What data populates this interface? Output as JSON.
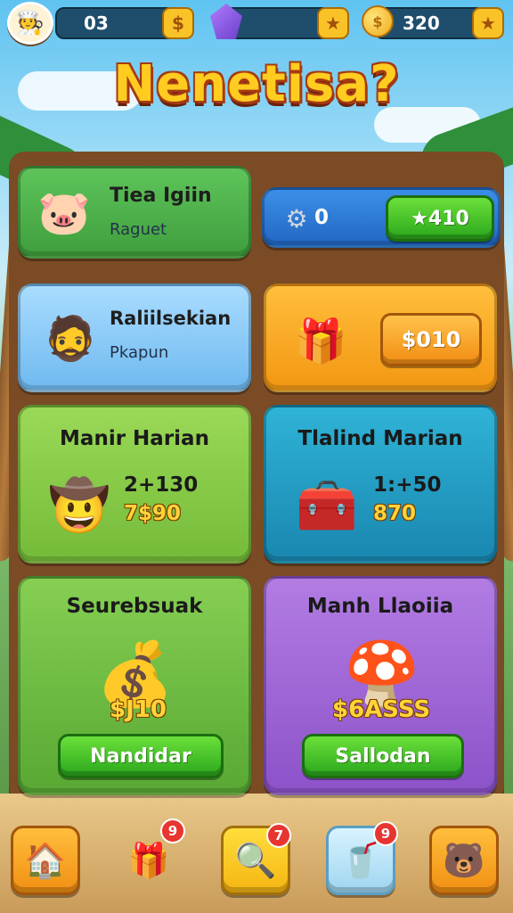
{
  "topbar": {
    "avatar_icon": "chef-avatar-icon",
    "level_value": "03",
    "level_badge_icon": "dollar-icon",
    "gem_icon": "purple-gem-icon",
    "gem_badge_icon": "star-icon",
    "coin_value": "320",
    "coin_badge_icon": "star-icon"
  },
  "title": "Nenetisa?",
  "cards": {
    "profile": {
      "name": "Tiea Igiin",
      "subtitle": "Raguet",
      "icon": "piglet-icon"
    },
    "counter": {
      "value": "0",
      "button_value": "410",
      "icon": "gear-icon",
      "button_icon": "star-icon"
    },
    "character": {
      "name": "Raliilsekian",
      "subtitle": "Pkapun",
      "icon": "fisherman-icon"
    },
    "chest_offer": {
      "price": "$010",
      "icon": "pink-chest-icon"
    },
    "manir": {
      "heading": "Manir Harian",
      "value1": "2+130",
      "value2": "7$90",
      "icon": "cowboy-icon"
    },
    "tralind": {
      "heading": "Tlalind Marian",
      "value1": "1:+50",
      "value2": "870",
      "icon": "treasure-chest-icon"
    },
    "seurebsuak": {
      "heading": "Seurebsuak",
      "overlay_value": "$J10",
      "button_label": "Nandidar",
      "icon": "purple-chest-icon"
    },
    "manh": {
      "heading": "Manh Llaoiia",
      "overlay_value": "$6ASSS",
      "button_label": "Sallodan",
      "icon": "mushroom-house-icon"
    }
  },
  "nav": {
    "home_icon": "house-icon",
    "shop_icon": "gift-chest-icon",
    "shop_badge": "9",
    "search_icon": "magnifier-icon",
    "search_badge": "7",
    "cup_icon": "cup-icon",
    "cup_badge": "9",
    "profile_icon": "pet-icon"
  },
  "colors": {
    "green": "#5cb85a",
    "blue": "#2f8fe0",
    "light_blue": "#7fc7f5",
    "orange": "#f9a52b",
    "lime": "#8fd14f",
    "teal": "#2aa9cf",
    "purple": "#a06ad6"
  }
}
